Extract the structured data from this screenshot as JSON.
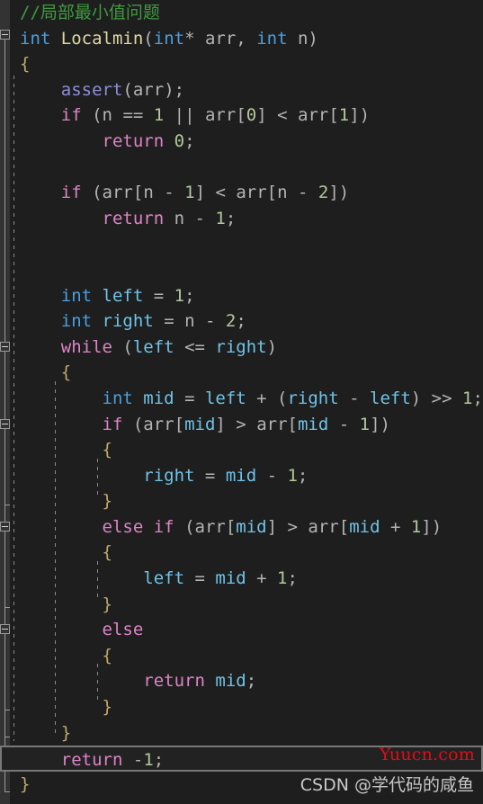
{
  "editor": {
    "language": "cpp",
    "background_color": "#1e1e1e",
    "gutter_color": "#333333",
    "current_line": 31,
    "current_line_border_color": "#787878"
  },
  "watermarks": {
    "site": "Yuucn.com",
    "site_color": "#e50b15",
    "author": "CSDN @学代码的咸鱼",
    "author_color": "#c8c8c8"
  },
  "code_lines": [
    {
      "n": 1,
      "tokens": [
        {
          "t": "//局部最小值问题",
          "c": "t-comment"
        }
      ]
    },
    {
      "n": 2,
      "tokens": [
        {
          "t": "int",
          "c": "t-type"
        },
        {
          "t": " ",
          "c": "t-punc"
        },
        {
          "t": "Localmin",
          "c": "t-func"
        },
        {
          "t": "(",
          "c": "t-punc"
        },
        {
          "t": "int",
          "c": "t-type"
        },
        {
          "t": "* ",
          "c": "t-punc"
        },
        {
          "t": "arr",
          "c": "t-ident"
        },
        {
          "t": ", ",
          "c": "t-punc"
        },
        {
          "t": "int",
          "c": "t-type"
        },
        {
          "t": " ",
          "c": "t-punc"
        },
        {
          "t": "n",
          "c": "t-ident"
        },
        {
          "t": ")",
          "c": "t-punc"
        }
      ]
    },
    {
      "n": 3,
      "tokens": [
        {
          "t": "{",
          "c": "t-brace"
        }
      ]
    },
    {
      "n": 4,
      "tokens": [
        {
          "t": "    ",
          "c": "t-punc"
        },
        {
          "t": "assert",
          "c": "t-macro"
        },
        {
          "t": "(",
          "c": "t-punc"
        },
        {
          "t": "arr",
          "c": "t-ident"
        },
        {
          "t": ");",
          "c": "t-punc"
        }
      ]
    },
    {
      "n": 5,
      "tokens": [
        {
          "t": "    ",
          "c": "t-punc"
        },
        {
          "t": "if",
          "c": "t-keyword"
        },
        {
          "t": " (",
          "c": "t-punc"
        },
        {
          "t": "n",
          "c": "t-ident"
        },
        {
          "t": " == ",
          "c": "t-op"
        },
        {
          "t": "1",
          "c": "t-num"
        },
        {
          "t": " || ",
          "c": "t-op"
        },
        {
          "t": "arr",
          "c": "t-ident"
        },
        {
          "t": "[",
          "c": "t-punc"
        },
        {
          "t": "0",
          "c": "t-num"
        },
        {
          "t": "] ",
          "c": "t-punc"
        },
        {
          "t": "< ",
          "c": "t-op"
        },
        {
          "t": "arr",
          "c": "t-ident"
        },
        {
          "t": "[",
          "c": "t-punc"
        },
        {
          "t": "1",
          "c": "t-num"
        },
        {
          "t": "])",
          "c": "t-punc"
        }
      ]
    },
    {
      "n": 6,
      "tokens": [
        {
          "t": "        ",
          "c": "t-punc"
        },
        {
          "t": "return",
          "c": "t-keyword"
        },
        {
          "t": " ",
          "c": "t-punc"
        },
        {
          "t": "0",
          "c": "t-num"
        },
        {
          "t": ";",
          "c": "t-punc"
        }
      ]
    },
    {
      "n": 7,
      "tokens": []
    },
    {
      "n": 8,
      "tokens": [
        {
          "t": "    ",
          "c": "t-punc"
        },
        {
          "t": "if",
          "c": "t-keyword"
        },
        {
          "t": " (",
          "c": "t-punc"
        },
        {
          "t": "arr",
          "c": "t-ident"
        },
        {
          "t": "[",
          "c": "t-punc"
        },
        {
          "t": "n",
          "c": "t-ident"
        },
        {
          "t": " - ",
          "c": "t-op"
        },
        {
          "t": "1",
          "c": "t-num"
        },
        {
          "t": "] ",
          "c": "t-punc"
        },
        {
          "t": "< ",
          "c": "t-op"
        },
        {
          "t": "arr",
          "c": "t-ident"
        },
        {
          "t": "[",
          "c": "t-punc"
        },
        {
          "t": "n",
          "c": "t-ident"
        },
        {
          "t": " - ",
          "c": "t-op"
        },
        {
          "t": "2",
          "c": "t-num"
        },
        {
          "t": "])",
          "c": "t-punc"
        }
      ]
    },
    {
      "n": 9,
      "tokens": [
        {
          "t": "        ",
          "c": "t-punc"
        },
        {
          "t": "return",
          "c": "t-keyword"
        },
        {
          "t": " ",
          "c": "t-punc"
        },
        {
          "t": "n",
          "c": "t-ident"
        },
        {
          "t": " - ",
          "c": "t-op"
        },
        {
          "t": "1",
          "c": "t-num"
        },
        {
          "t": ";",
          "c": "t-punc"
        }
      ]
    },
    {
      "n": 10,
      "tokens": []
    },
    {
      "n": 11,
      "tokens": []
    },
    {
      "n": 12,
      "tokens": [
        {
          "t": "    ",
          "c": "t-punc"
        },
        {
          "t": "int",
          "c": "t-type"
        },
        {
          "t": " ",
          "c": "t-punc"
        },
        {
          "t": "left",
          "c": "t-var"
        },
        {
          "t": " = ",
          "c": "t-op"
        },
        {
          "t": "1",
          "c": "t-num"
        },
        {
          "t": ";",
          "c": "t-punc"
        }
      ]
    },
    {
      "n": 13,
      "tokens": [
        {
          "t": "    ",
          "c": "t-punc"
        },
        {
          "t": "int",
          "c": "t-type"
        },
        {
          "t": " ",
          "c": "t-punc"
        },
        {
          "t": "right",
          "c": "t-var"
        },
        {
          "t": " = ",
          "c": "t-op"
        },
        {
          "t": "n",
          "c": "t-ident"
        },
        {
          "t": " - ",
          "c": "t-op"
        },
        {
          "t": "2",
          "c": "t-num"
        },
        {
          "t": ";",
          "c": "t-punc"
        }
      ]
    },
    {
      "n": 14,
      "tokens": [
        {
          "t": "    ",
          "c": "t-punc"
        },
        {
          "t": "while",
          "c": "t-keyword"
        },
        {
          "t": " (",
          "c": "t-punc"
        },
        {
          "t": "left",
          "c": "t-var"
        },
        {
          "t": " <= ",
          "c": "t-op"
        },
        {
          "t": "right",
          "c": "t-var"
        },
        {
          "t": ")",
          "c": "t-punc"
        }
      ]
    },
    {
      "n": 15,
      "tokens": [
        {
          "t": "    ",
          "c": "t-punc"
        },
        {
          "t": "{",
          "c": "t-brace"
        }
      ]
    },
    {
      "n": 16,
      "tokens": [
        {
          "t": "        ",
          "c": "t-punc"
        },
        {
          "t": "int",
          "c": "t-type"
        },
        {
          "t": " ",
          "c": "t-punc"
        },
        {
          "t": "mid",
          "c": "t-var"
        },
        {
          "t": " = ",
          "c": "t-op"
        },
        {
          "t": "left",
          "c": "t-var"
        },
        {
          "t": " + (",
          "c": "t-op"
        },
        {
          "t": "right",
          "c": "t-var"
        },
        {
          "t": " - ",
          "c": "t-op"
        },
        {
          "t": "left",
          "c": "t-var"
        },
        {
          "t": ") ",
          "c": "t-punc"
        },
        {
          "t": ">> ",
          "c": "t-op"
        },
        {
          "t": "1",
          "c": "t-num"
        },
        {
          "t": ";",
          "c": "t-punc"
        }
      ]
    },
    {
      "n": 17,
      "tokens": [
        {
          "t": "        ",
          "c": "t-punc"
        },
        {
          "t": "if",
          "c": "t-keyword"
        },
        {
          "t": " (",
          "c": "t-punc"
        },
        {
          "t": "arr",
          "c": "t-ident"
        },
        {
          "t": "[",
          "c": "t-punc"
        },
        {
          "t": "mid",
          "c": "t-var"
        },
        {
          "t": "] ",
          "c": "t-punc"
        },
        {
          "t": "> ",
          "c": "t-op"
        },
        {
          "t": "arr",
          "c": "t-ident"
        },
        {
          "t": "[",
          "c": "t-punc"
        },
        {
          "t": "mid",
          "c": "t-var"
        },
        {
          "t": " - ",
          "c": "t-op"
        },
        {
          "t": "1",
          "c": "t-num"
        },
        {
          "t": "])",
          "c": "t-punc"
        }
      ]
    },
    {
      "n": 18,
      "tokens": [
        {
          "t": "        ",
          "c": "t-punc"
        },
        {
          "t": "{",
          "c": "t-brace"
        }
      ]
    },
    {
      "n": 19,
      "tokens": [
        {
          "t": "            ",
          "c": "t-punc"
        },
        {
          "t": "right",
          "c": "t-var"
        },
        {
          "t": " = ",
          "c": "t-op"
        },
        {
          "t": "mid",
          "c": "t-var"
        },
        {
          "t": " - ",
          "c": "t-op"
        },
        {
          "t": "1",
          "c": "t-num"
        },
        {
          "t": ";",
          "c": "t-punc"
        }
      ]
    },
    {
      "n": 20,
      "tokens": [
        {
          "t": "        ",
          "c": "t-punc"
        },
        {
          "t": "}",
          "c": "t-brace"
        }
      ]
    },
    {
      "n": 21,
      "tokens": [
        {
          "t": "        ",
          "c": "t-punc"
        },
        {
          "t": "else",
          "c": "t-keyword"
        },
        {
          "t": " ",
          "c": "t-punc"
        },
        {
          "t": "if",
          "c": "t-keyword"
        },
        {
          "t": " (",
          "c": "t-punc"
        },
        {
          "t": "arr",
          "c": "t-ident"
        },
        {
          "t": "[",
          "c": "t-punc"
        },
        {
          "t": "mid",
          "c": "t-var"
        },
        {
          "t": "] ",
          "c": "t-punc"
        },
        {
          "t": "> ",
          "c": "t-op"
        },
        {
          "t": "arr",
          "c": "t-ident"
        },
        {
          "t": "[",
          "c": "t-punc"
        },
        {
          "t": "mid",
          "c": "t-var"
        },
        {
          "t": " + ",
          "c": "t-op"
        },
        {
          "t": "1",
          "c": "t-num"
        },
        {
          "t": "])",
          "c": "t-punc"
        }
      ]
    },
    {
      "n": 22,
      "tokens": [
        {
          "t": "        ",
          "c": "t-punc"
        },
        {
          "t": "{",
          "c": "t-brace"
        }
      ]
    },
    {
      "n": 23,
      "tokens": [
        {
          "t": "            ",
          "c": "t-punc"
        },
        {
          "t": "left",
          "c": "t-var"
        },
        {
          "t": " = ",
          "c": "t-op"
        },
        {
          "t": "mid",
          "c": "t-var"
        },
        {
          "t": " + ",
          "c": "t-op"
        },
        {
          "t": "1",
          "c": "t-num"
        },
        {
          "t": ";",
          "c": "t-punc"
        }
      ]
    },
    {
      "n": 24,
      "tokens": [
        {
          "t": "        ",
          "c": "t-punc"
        },
        {
          "t": "}",
          "c": "t-brace"
        }
      ]
    },
    {
      "n": 25,
      "tokens": [
        {
          "t": "        ",
          "c": "t-punc"
        },
        {
          "t": "else",
          "c": "t-keyword"
        }
      ]
    },
    {
      "n": 26,
      "tokens": [
        {
          "t": "        ",
          "c": "t-punc"
        },
        {
          "t": "{",
          "c": "t-brace"
        }
      ]
    },
    {
      "n": 27,
      "tokens": [
        {
          "t": "            ",
          "c": "t-punc"
        },
        {
          "t": "return",
          "c": "t-keyword"
        },
        {
          "t": " ",
          "c": "t-punc"
        },
        {
          "t": "mid",
          "c": "t-var"
        },
        {
          "t": ";",
          "c": "t-punc"
        }
      ]
    },
    {
      "n": 28,
      "tokens": [
        {
          "t": "        ",
          "c": "t-punc"
        },
        {
          "t": "}",
          "c": "t-brace"
        }
      ]
    },
    {
      "n": 29,
      "tokens": [
        {
          "t": "    ",
          "c": "t-punc"
        },
        {
          "t": "}",
          "c": "t-brace"
        }
      ]
    },
    {
      "n": 30,
      "tokens": [
        {
          "t": "    ",
          "c": "t-punc"
        },
        {
          "t": "return",
          "c": "t-keyword"
        },
        {
          "t": " ",
          "c": "t-punc"
        },
        {
          "t": "-",
          "c": "t-op"
        },
        {
          "t": "1",
          "c": "t-num"
        },
        {
          "t": ";",
          "c": "t-punc"
        }
      ]
    },
    {
      "n": 31,
      "tokens": [
        {
          "t": "}",
          "c": "t-brace"
        }
      ]
    }
  ]
}
